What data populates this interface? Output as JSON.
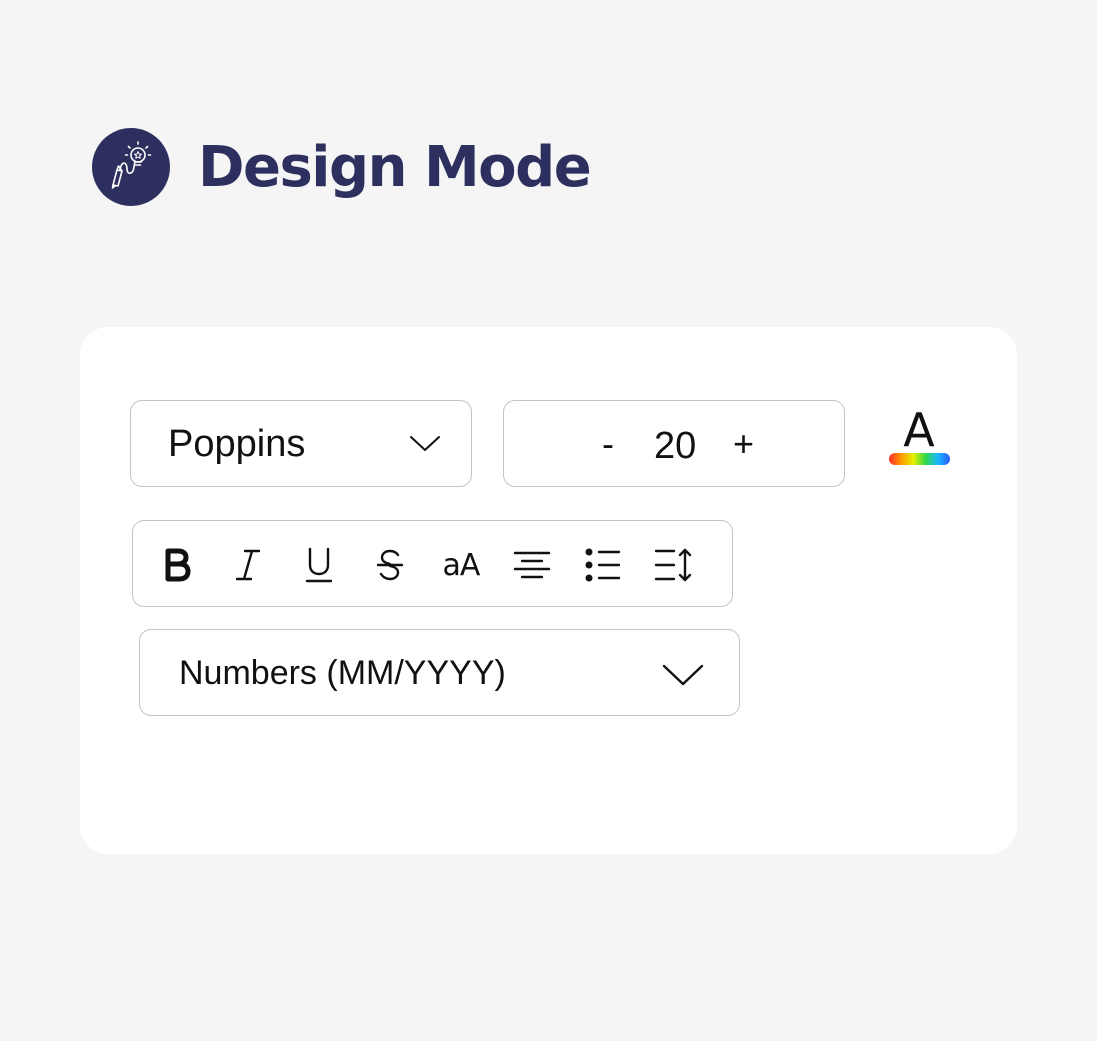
{
  "header": {
    "title": "Design Mode",
    "logo_icon": "pencil-lightbulb-icon",
    "brand_color": "#2d2f5e"
  },
  "toolbar": {
    "font_family": {
      "selected": "Poppins",
      "icon": "chevron-down-icon"
    },
    "font_size": {
      "decrement_label": "-",
      "value": "20",
      "increment_label": "+"
    },
    "text_color": {
      "letter": "A",
      "icon": "text-color-rainbow-icon"
    },
    "formatting": [
      {
        "name": "bold",
        "icon": "bold-icon"
      },
      {
        "name": "italic",
        "icon": "italic-icon"
      },
      {
        "name": "underline",
        "icon": "underline-icon"
      },
      {
        "name": "strikethrough",
        "icon": "strikethrough-icon"
      },
      {
        "name": "text-case",
        "icon": "text-case-icon",
        "glyph": "aA"
      },
      {
        "name": "align-center",
        "icon": "align-center-icon"
      },
      {
        "name": "bullet-list",
        "icon": "bullet-list-icon"
      },
      {
        "name": "line-spacing",
        "icon": "line-spacing-icon"
      }
    ],
    "date_format": {
      "selected": "Numbers (MM/YYYY)",
      "icon": "chevron-down-icon"
    }
  }
}
